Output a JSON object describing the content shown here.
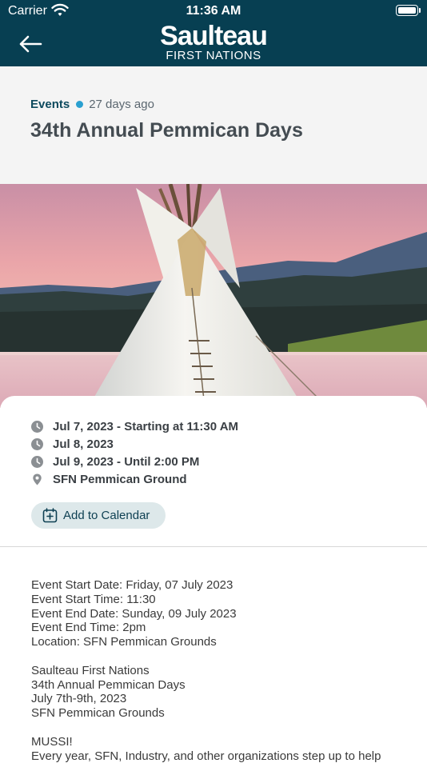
{
  "status_bar": {
    "carrier": "Carrier",
    "time": "11:36 AM"
  },
  "nav": {
    "logo_main": "Saulteau",
    "logo_sub": "FIRST NATIONS"
  },
  "post": {
    "category": "Events",
    "time_ago": "27 days ago",
    "title": "34th Annual Pemmican Days"
  },
  "details": [
    {
      "icon": "clock-icon",
      "text": "Jul 7, 2023 - Starting at 11:30 AM"
    },
    {
      "icon": "clock-icon",
      "text": "Jul 8, 2023"
    },
    {
      "icon": "clock-icon",
      "text": "Jul 9, 2023 - Until 2:00 PM"
    },
    {
      "icon": "location-pin-icon",
      "text": "SFN Pemmican Ground"
    }
  ],
  "calendar_button": {
    "label": "Add to Calendar",
    "icon": "calendar-add-icon"
  },
  "description": {
    "block1": [
      "Event Start Date: Friday, 07 July 2023",
      "Event Start Time: 11:30",
      "Event End Date: Sunday, 09 July 2023",
      "Event End Time: 2pm",
      "Location: SFN Pemmican Grounds"
    ],
    "block2": [
      "Saulteau First Nations",
      "34th Annual Pemmican Days",
      "July 7th-9th, 2023",
      "SFN Pemmican Grounds"
    ],
    "block3": [
      "MUSSI!",
      "Every year, SFN, Industry, and other organizations step up to help"
    ]
  },
  "colors": {
    "header_bg": "#073f52",
    "accent_dot": "#2aa0d0",
    "category_text": "#0d4a5e",
    "button_bg": "#dde8ea"
  }
}
